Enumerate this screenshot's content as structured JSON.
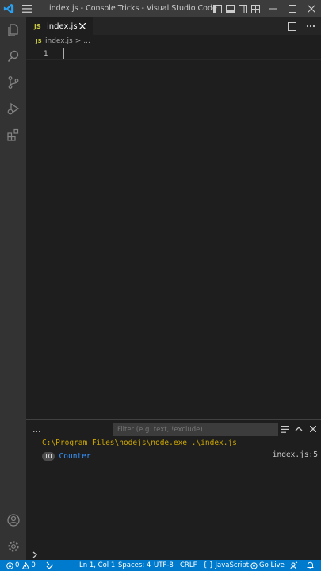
{
  "window": {
    "title": "index.js - Console Tricks - Visual Studio Code",
    "accent": "#007acc"
  },
  "editor": {
    "tab": {
      "badge": "JS",
      "label": "index.js"
    },
    "breadcrumb": {
      "badge": "JS",
      "file": "index.js",
      "separator": ">",
      "more": "..."
    },
    "line_number": "1"
  },
  "panel": {
    "more_label": "...",
    "filter": {
      "placeholder": "Filter (e.g. text, !exclude)",
      "value": ""
    },
    "output": [
      {
        "text": "C:\\Program Files\\nodejs\\node.exe .\\index.js",
        "color": "#cca700"
      },
      {
        "count": "10",
        "text": "Counter",
        "source": "index.js:5",
        "color": "#3794ff"
      }
    ],
    "prompt": ">"
  },
  "statusbar": {
    "errors": "0",
    "warnings": "0",
    "position": "Ln 1, Col 1",
    "spaces": "Spaces: 4",
    "encoding": "UTF-8",
    "eol": "CRLF",
    "language_braces": "{ }",
    "language": "JavaScript",
    "go_live": "Go Live"
  },
  "icons": [
    "vscode-logo-icon",
    "hamburger-menu-icon",
    "layout-icons",
    "explorer-icon",
    "search-icon",
    "source-control-icon",
    "run-debug-icon",
    "extensions-icon",
    "account-icon",
    "manage-gear-icon",
    "split-editor-icon",
    "more-actions-icon",
    "close-icon",
    "clear-console-icon",
    "chevron-up-icon",
    "remote-icon",
    "error-icon",
    "warning-icon",
    "broadcast-icon",
    "feedback-icon",
    "bell-icon"
  ]
}
